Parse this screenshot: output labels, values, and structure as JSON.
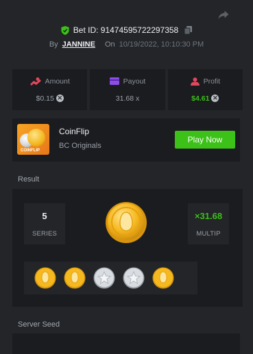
{
  "header": {
    "bet_id": "Bet ID: 91474595722297358",
    "by_label": "By",
    "username": "JANNINE",
    "on_label": "On",
    "date": "10/19/2022, 10:10:30 PM"
  },
  "stats": [
    {
      "label": "Amount",
      "value": "$0.15",
      "icon": "hand-coins-icon",
      "icon_color": "#e0485e"
    },
    {
      "label": "Payout",
      "value": "31.68 x",
      "icon": "card-icon",
      "icon_color": "#8d4ee8"
    },
    {
      "label": "Profit",
      "value": "$4.61",
      "icon": "person-icon",
      "icon_color": "#e0485e"
    }
  ],
  "game": {
    "thumb_text": "COINFLIP",
    "name": "CoinFlip",
    "provider": "BC Originals",
    "play_label": "Play Now"
  },
  "result": {
    "label": "Result",
    "series_value": "5",
    "series_label": "SERIES",
    "multiplier_value": "×31.68",
    "multiplier_label": "MULTIP",
    "coins": [
      "gold",
      "gold",
      "silver",
      "silver",
      "gold"
    ]
  },
  "seed": {
    "label": "Server Seed"
  },
  "colors": {
    "accent_green": "#3bc117",
    "panel": "#1b1c1f",
    "background": "#232528"
  }
}
